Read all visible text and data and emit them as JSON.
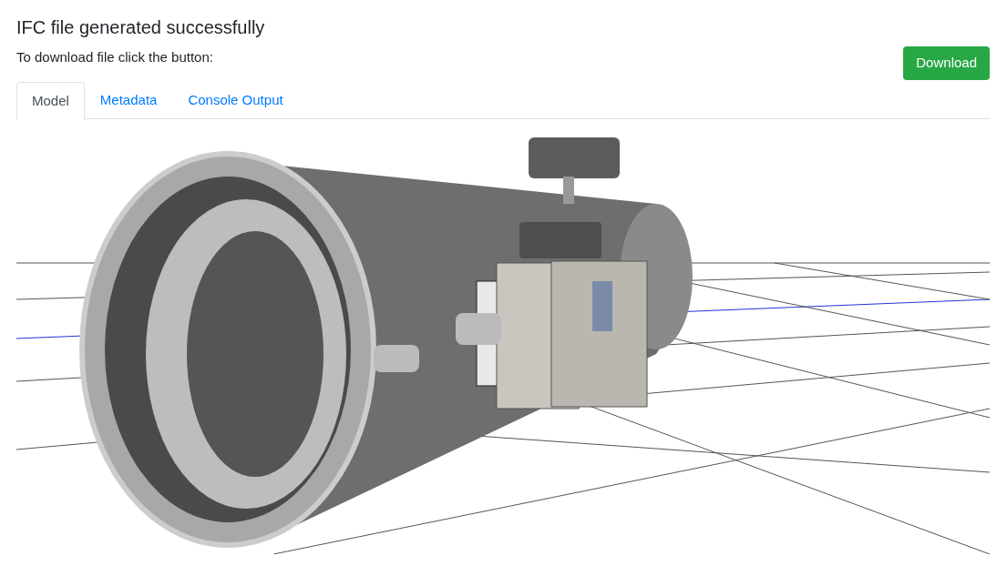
{
  "title": "IFC file generated successfully",
  "instruction": "To download file click the button:",
  "download_button": "Download",
  "tabs": [
    {
      "label": "Model",
      "selected": true
    },
    {
      "label": "Metadata",
      "selected": false
    },
    {
      "label": "Console Output",
      "selected": false
    }
  ]
}
